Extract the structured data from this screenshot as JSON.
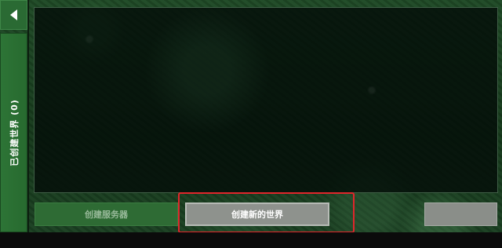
{
  "sidebar": {
    "back_icon": "back-arrow-icon",
    "created_worlds_tab": "已创建世界 (0)"
  },
  "world_list": {
    "items": []
  },
  "buttons": {
    "create_server": "创建服务器",
    "create_new_world": "创建新的世界",
    "right_action": ""
  },
  "colors": {
    "highlight": "#e0262b",
    "tab_green": "#2d7436",
    "button_gray": "#8e928d"
  }
}
